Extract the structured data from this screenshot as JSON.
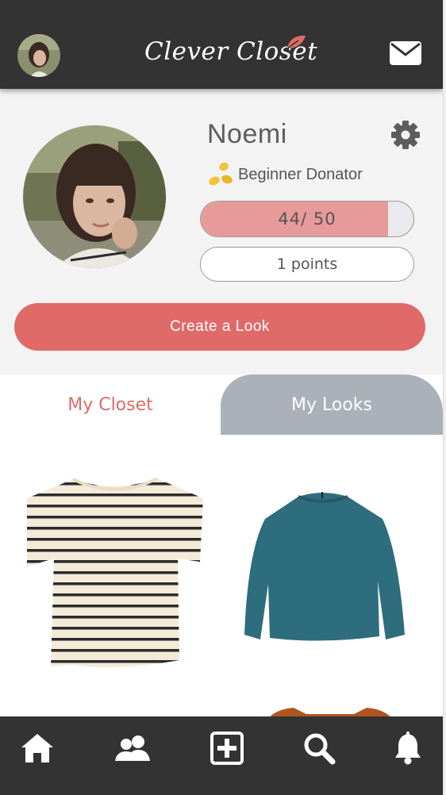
{
  "header": {
    "logo_text": "Clever Closet",
    "avatar_icon": "user-avatar",
    "mail_icon": "envelope-icon"
  },
  "profile": {
    "name": "Noemi",
    "badge": "Beginner Donator",
    "badge_icon": "coins-icon",
    "progress_label": "44/ 50",
    "progress_value": 44,
    "progress_max": 50,
    "points_label": "1 points",
    "settings_icon": "gear-icon"
  },
  "actions": {
    "create_look": "Create a Look"
  },
  "tabs": [
    {
      "label": "My Closet",
      "active": true
    },
    {
      "label": "My Looks",
      "active": false
    }
  ],
  "closet_items": [
    {
      "name": "striped-tshirt",
      "colors": [
        "#f3ead8",
        "#2b2b2b"
      ]
    },
    {
      "name": "teal-sweater",
      "colors": [
        "#2e6d7d"
      ]
    },
    {
      "name": "brown-top",
      "colors": [
        "#b0551f"
      ]
    }
  ],
  "bottom_nav": [
    {
      "icon": "home-icon"
    },
    {
      "icon": "friends-icon"
    },
    {
      "icon": "add-icon"
    },
    {
      "icon": "search-icon"
    },
    {
      "icon": "bell-icon"
    }
  ],
  "colors": {
    "header_bg": "#333333",
    "accent": "#e06a68",
    "tab_inactive": "#abb1b9",
    "progress_fill": "#e69a99"
  }
}
